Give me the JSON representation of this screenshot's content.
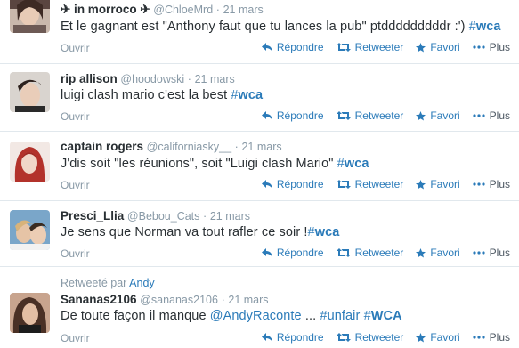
{
  "tweets": [
    {
      "fullname": "✈ in morroco ✈",
      "username": "@ChloeMrd",
      "dot": "·",
      "time": "21 mars",
      "text_plain": "Et le gagnant est \"Anthony faut que tu lances la pub\" ptdddddddddr :') ",
      "hashtag_hash": "#",
      "hashtag_word": "wca",
      "open": "Ouvrir"
    },
    {
      "fullname": "rip allison",
      "username": "@hoodowski",
      "dot": "·",
      "time": "21 mars",
      "text_plain": "luigi clash mario c'est la best ",
      "hashtag_hash": "#",
      "hashtag_word": "wca",
      "open": "Ouvrir"
    },
    {
      "fullname": "captain rogers",
      "username": "@californiasky__",
      "dot": "·",
      "time": "21 mars",
      "text_plain": "J'dis soit \"les réunions\", soit \"Luigi clash Mario\" ",
      "hashtag_hash": "#",
      "hashtag_word": "wca",
      "open": "Ouvrir"
    },
    {
      "fullname": "Presci_Llia",
      "username": "@Bebou_Cats",
      "dot": "·",
      "time": "21 mars",
      "text_plain": "Je sens que Norman va tout rafler ce soir !",
      "hashtag_hash": "#",
      "hashtag_word": "wca",
      "open": "Ouvrir"
    },
    {
      "retweeted_prefix": "Retweeté par",
      "retweeted_user": "Andy",
      "fullname": "Sananas2106",
      "username": "@sananas2106",
      "dot": "·",
      "time": "21 mars",
      "text_prefix": "De toute façon il manque ",
      "mention": "@AndyRaconte",
      "text_middle": " ... ",
      "hashtag1_hash": "#",
      "hashtag1_word": "unfair",
      "hashtag2_hash": "#",
      "hashtag2_word": "WCA",
      "open": "Ouvrir"
    }
  ],
  "actions": {
    "reply": "Répondre",
    "retweet": "Retweeter",
    "favorite": "Favori",
    "more": "Plus"
  },
  "icons": {
    "reply": "reply-icon",
    "retweet": "retweet-icon",
    "favorite": "star-icon",
    "more": "more-dots-icon"
  },
  "colors": {
    "link": "#2b7bb9",
    "muted": "#8899a6",
    "text": "#292f33",
    "divider": "#e1e8ed"
  }
}
